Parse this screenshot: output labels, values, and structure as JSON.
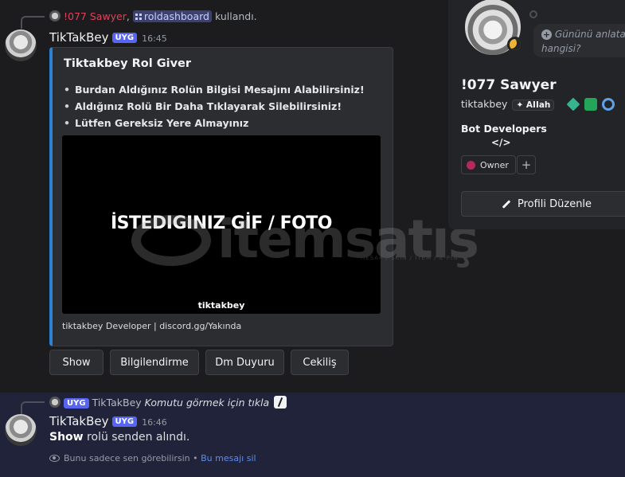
{
  "message1": {
    "context_user": "!077 Sawyer",
    "context_separator": ",",
    "context_command": "roldashboard",
    "context_suffix": "kullandı.",
    "author": "TikTakBey",
    "badge": "UYG",
    "time": "16:45",
    "embed": {
      "accent_color": "#2b83d4",
      "title": "Tiktakbey Rol Giver",
      "lines": [
        "Burdan Aldığınız Rolün Bilgisi Mesajını Alabilirsiniz!",
        "Aldığınız Rolü Bir Daha Tıklayarak Silebilirsiniz!",
        "Lütfen Gereksiz Yere Almayınız"
      ],
      "image_text": "İSTEDIGINIZ GİF / FOTO",
      "image_caption": "tiktakbey",
      "footer": "tiktakbey Developer | discord.gg/Yakında"
    },
    "buttons": [
      "Show",
      "Bilgilendirme",
      "Dm Duyuru",
      "Cekiliş"
    ]
  },
  "message2": {
    "context_badge": "UYG",
    "context_user": "TikTakBey",
    "context_text": "Komutu görmek için tıkla",
    "author": "TikTakBey",
    "badge": "UYG",
    "time": "16:46",
    "content_bold": "Show",
    "content_rest": " rolü senden alındı.",
    "ephemeral_text": "Bunu sadece sen görebilirsin • ",
    "ephemeral_link": "Bu mesajı sil"
  },
  "profile": {
    "bubble_line1": "Gününü anlata",
    "bubble_line2": "hangisi?",
    "display_name": "!077 Sawyer",
    "username": "tiktakbey",
    "tag": "AIIah",
    "section": "Bot Developers",
    "section_code": "</>",
    "role": "Owner",
    "role_color": "#b5285e",
    "add_role": "+",
    "edit_button": "Profili Düzenle"
  },
  "watermark": {
    "text": "itemsatış",
    "sub": "HESAP / SKIN / ITEM / E-PIN"
  }
}
